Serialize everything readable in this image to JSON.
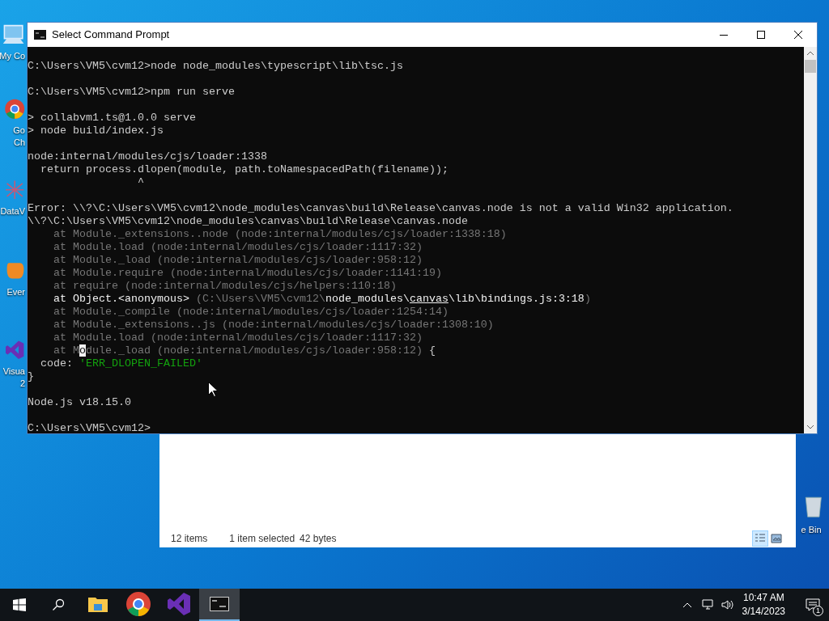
{
  "desktop_icons": [
    {
      "kind": "computer",
      "label_lines": [
        "My Co"
      ]
    },
    {
      "kind": "chrome",
      "label_lines": [
        "Go",
        "Ch"
      ]
    },
    {
      "kind": "dataviz",
      "label_lines": [
        "DataV"
      ]
    },
    {
      "kind": "evernote",
      "label_lines": [
        "Ever"
      ]
    },
    {
      "kind": "studio",
      "label_lines": [
        "Visua",
        "2"
      ]
    },
    {
      "kind": "recycle",
      "label_lines": [
        "e Bin"
      ]
    }
  ],
  "explorer": {
    "status": [
      "12 items",
      "1 item selected",
      "42 bytes"
    ],
    "views": [
      {
        "kind": "details",
        "selected": true
      },
      {
        "kind": "preview",
        "selected": false
      }
    ]
  },
  "console": {
    "title": "Select Command Prompt",
    "lines": [
      {
        "spans": [
          {
            "kind": "normal",
            "text": "C:\\Users\\VM5\\cvm12>node node_modules\\typescript\\lib\\tsc.js"
          }
        ]
      },
      {
        "kind": "blank"
      },
      {
        "spans": [
          {
            "kind": "normal",
            "text": "C:\\Users\\VM5\\cvm12>npm run serve"
          }
        ]
      },
      {
        "kind": "blank"
      },
      {
        "spans": [
          {
            "kind": "normal",
            "text": "> collabvm1.ts@1.0.0 serve"
          }
        ]
      },
      {
        "spans": [
          {
            "kind": "normal",
            "text": "> node build/index.js"
          }
        ]
      },
      {
        "kind": "blank"
      },
      {
        "spans": [
          {
            "kind": "normal",
            "text": "node:internal/modules/cjs/loader:1338"
          }
        ]
      },
      {
        "spans": [
          {
            "kind": "normal",
            "text": "  return process.dlopen(module, path.toNamespacedPath(filename));"
          }
        ]
      },
      {
        "spans": [
          {
            "kind": "normal",
            "text": "                 ^"
          }
        ]
      },
      {
        "kind": "blank"
      },
      {
        "spans": [
          {
            "kind": "normal",
            "text": "Error: \\\\?\\C:\\Users\\VM5\\cvm12\\node_modules\\canvas\\build\\Release\\canvas.node is not a valid Win32 application."
          }
        ]
      },
      {
        "spans": [
          {
            "kind": "normal",
            "text": "\\\\?\\C:\\Users\\VM5\\cvm12\\node_modules\\canvas\\build\\Release\\canvas.node"
          }
        ]
      },
      {
        "spans": [
          {
            "kind": "dim",
            "text": "    at Module._extensions..node (node:internal/modules/cjs/loader:1338:18)"
          }
        ]
      },
      {
        "spans": [
          {
            "kind": "dim",
            "text": "    at Module.load (node:internal/modules/cjs/loader:1117:32)"
          }
        ]
      },
      {
        "spans": [
          {
            "kind": "dim",
            "text": "    at Module._load (node:internal/modules/cjs/loader:958:12)"
          }
        ]
      },
      {
        "spans": [
          {
            "kind": "dim",
            "text": "    at Module.require (node:internal/modules/cjs/loader:1141:19)"
          }
        ]
      },
      {
        "spans": [
          {
            "kind": "dim",
            "text": "    at require (node:internal/modules/cjs/helpers:110:18)"
          }
        ]
      },
      {
        "spans": [
          {
            "kind": "bright",
            "text": "    at Object.<anonymous> "
          },
          {
            "kind": "dim",
            "text": "(C:\\Users\\VM5\\cvm12\\"
          },
          {
            "kind": "bright",
            "text": "node_modules\\"
          },
          {
            "kind": "underline",
            "text": "canvas"
          },
          {
            "kind": "bright",
            "text": "\\lib\\bindings.js:3:18"
          },
          {
            "kind": "dim",
            "text": ")"
          }
        ]
      },
      {
        "spans": [
          {
            "kind": "dim",
            "text": "    at Module._compile (node:internal/modules/cjs/loader:1254:14)"
          }
        ]
      },
      {
        "spans": [
          {
            "kind": "dim",
            "text": "    at Module._extensions..js (node:internal/modules/cjs/loader:1308:10)"
          }
        ]
      },
      {
        "spans": [
          {
            "kind": "dim",
            "text": "    at Module.load (node:internal/modules/cjs/loader:1117:32)"
          }
        ]
      },
      {
        "spans": [
          {
            "kind": "dim",
            "text": "    at M"
          },
          {
            "kind": "cursor",
            "text": "o"
          },
          {
            "kind": "dim",
            "text": "dule._load (node:internal/modules/cjs/loader:958:12) "
          },
          {
            "kind": "normal",
            "text": "{"
          }
        ]
      },
      {
        "spans": [
          {
            "kind": "normal",
            "text": "  code: "
          },
          {
            "kind": "green",
            "text": "'ERR_DLOPEN_FAILED'"
          }
        ]
      },
      {
        "spans": [
          {
            "kind": "normal",
            "text": "}"
          }
        ]
      },
      {
        "kind": "blank"
      },
      {
        "spans": [
          {
            "kind": "normal",
            "text": "Node.js v18.15.0"
          }
        ]
      },
      {
        "kind": "blank"
      },
      {
        "spans": [
          {
            "kind": "normal",
            "text": "C:\\Users\\VM5\\cvm12>"
          }
        ]
      }
    ]
  },
  "taskbar": {
    "apps": [
      {
        "kind": "explorer",
        "active": false
      },
      {
        "kind": "chrome",
        "active": false
      },
      {
        "kind": "studio",
        "active": false
      },
      {
        "kind": "console",
        "active": true
      }
    ],
    "time": "10:47 AM",
    "date": "3/14/2023",
    "notification_count": "1"
  }
}
